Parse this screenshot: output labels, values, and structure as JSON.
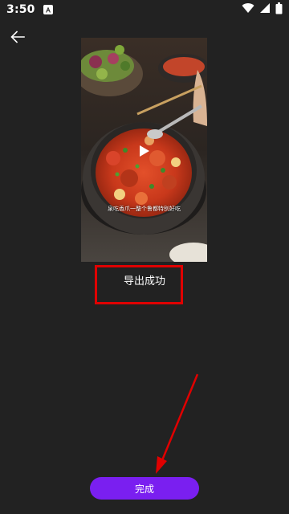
{
  "status_bar": {
    "time": "3:50",
    "notification_icon": "a-letter-icon",
    "icons": [
      "wifi-icon",
      "signal-icon",
      "battery-icon"
    ]
  },
  "header": {
    "back_icon": "arrow-left-icon"
  },
  "preview": {
    "subtitle": "泉吃香爪一整个鲁都特别好吃",
    "play_icon": "play-icon"
  },
  "main": {
    "status_text": "导出成功"
  },
  "footer": {
    "done_label": "完成"
  },
  "colors": {
    "background": "#222222",
    "accent": "#7a1ff0",
    "annotation": "#e00000"
  }
}
